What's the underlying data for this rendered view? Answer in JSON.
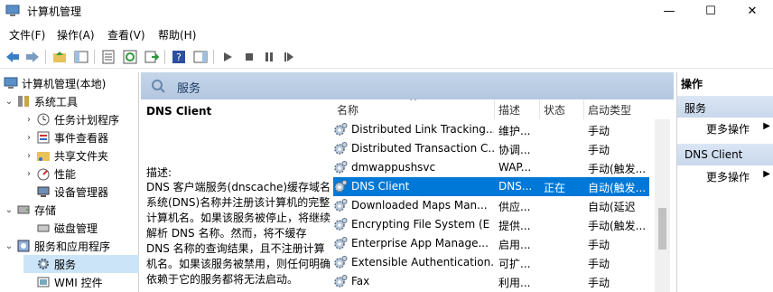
{
  "window": {
    "title": "计算机管理",
    "min_glyph": "—",
    "max_glyph": "☐",
    "close_glyph": "✕"
  },
  "menu": [
    "文件(F)",
    "操作(A)",
    "查看(V)",
    "帮助(H)"
  ],
  "tree": {
    "root": "计算机管理(本地)",
    "items": [
      {
        "label": "系统工具",
        "level": 1,
        "expander": "⌄",
        "icon": "tools-icon"
      },
      {
        "label": "任务计划程序",
        "level": 2,
        "expander": "›",
        "icon": "clock-icon"
      },
      {
        "label": "事件查看器",
        "level": 2,
        "expander": "›",
        "icon": "event-viewer-icon"
      },
      {
        "label": "共享文件夹",
        "level": 2,
        "expander": "›",
        "icon": "shared-folder-icon"
      },
      {
        "label": "性能",
        "level": 2,
        "expander": "›",
        "icon": "performance-icon"
      },
      {
        "label": "设备管理器",
        "level": 2,
        "expander": "",
        "icon": "device-manager-icon"
      },
      {
        "label": "存储",
        "level": 1,
        "expander": "⌄",
        "icon": "storage-icon"
      },
      {
        "label": "磁盘管理",
        "level": 2,
        "expander": "",
        "icon": "disk-icon"
      },
      {
        "label": "服务和应用程序",
        "level": 1,
        "expander": "⌄",
        "icon": "services-apps-icon"
      },
      {
        "label": "服务",
        "level": 2,
        "expander": "",
        "icon": "services-icon",
        "selected": true
      },
      {
        "label": "WMI 控件",
        "level": 2,
        "expander": "",
        "icon": "wmi-icon"
      }
    ]
  },
  "center": {
    "header_title": "服务",
    "desc_title": "DNS Client",
    "desc_label": "描述:",
    "desc_text": "DNS 客户端服务(dnscache)缓存域名系统(DNS)名称并注册该计算机的完整计算机名。如果该服务被停止，将继续解析 DNS 名称。然而，将不缓存 DNS 名称的查询结果，且不注册计算机名。如果该服务被禁用，则任何明确依赖于它的服务都将无法启动。",
    "columns": {
      "name": "名称",
      "description": "描述",
      "status": "状态",
      "startup": "启动类型"
    },
    "sort_glyph": "^",
    "rows": [
      {
        "name": "Distributed Link Tracking...",
        "description": "维护...",
        "status": "",
        "startup": "手动"
      },
      {
        "name": "Distributed Transaction C...",
        "description": "协调...",
        "status": "",
        "startup": "手动"
      },
      {
        "name": "dmwappushsvc",
        "description": "WAP...",
        "status": "",
        "startup": "手动(触发..."
      },
      {
        "name": "DNS Client",
        "description": "DNS...",
        "status": "正在",
        "startup": "自动(触发...",
        "selected": true
      },
      {
        "name": "Downloaded Maps Man...",
        "description": "供应...",
        "status": "",
        "startup": "自动(延迟"
      },
      {
        "name": "Encrypting File System (E",
        "description": "提供...",
        "status": "",
        "startup": "手动(触发..."
      },
      {
        "name": "Enterprise App Manage...",
        "description": "启用...",
        "status": "",
        "startup": "手动"
      },
      {
        "name": "Extensible Authentication...",
        "description": "可扩...",
        "status": "",
        "startup": "手动"
      },
      {
        "name": "Fax",
        "description": "利用...",
        "status": "",
        "startup": "手动"
      }
    ]
  },
  "actions": {
    "title": "操作",
    "sections": [
      {
        "label": "服务",
        "link": "更多操作",
        "arrow": "▶"
      },
      {
        "label": "DNS Client",
        "link": "更多操作",
        "arrow": "▶"
      }
    ]
  },
  "colors": {
    "selection": "#0078d7",
    "tree_selection": "#cce4f7",
    "header": "#b3c7e0"
  }
}
